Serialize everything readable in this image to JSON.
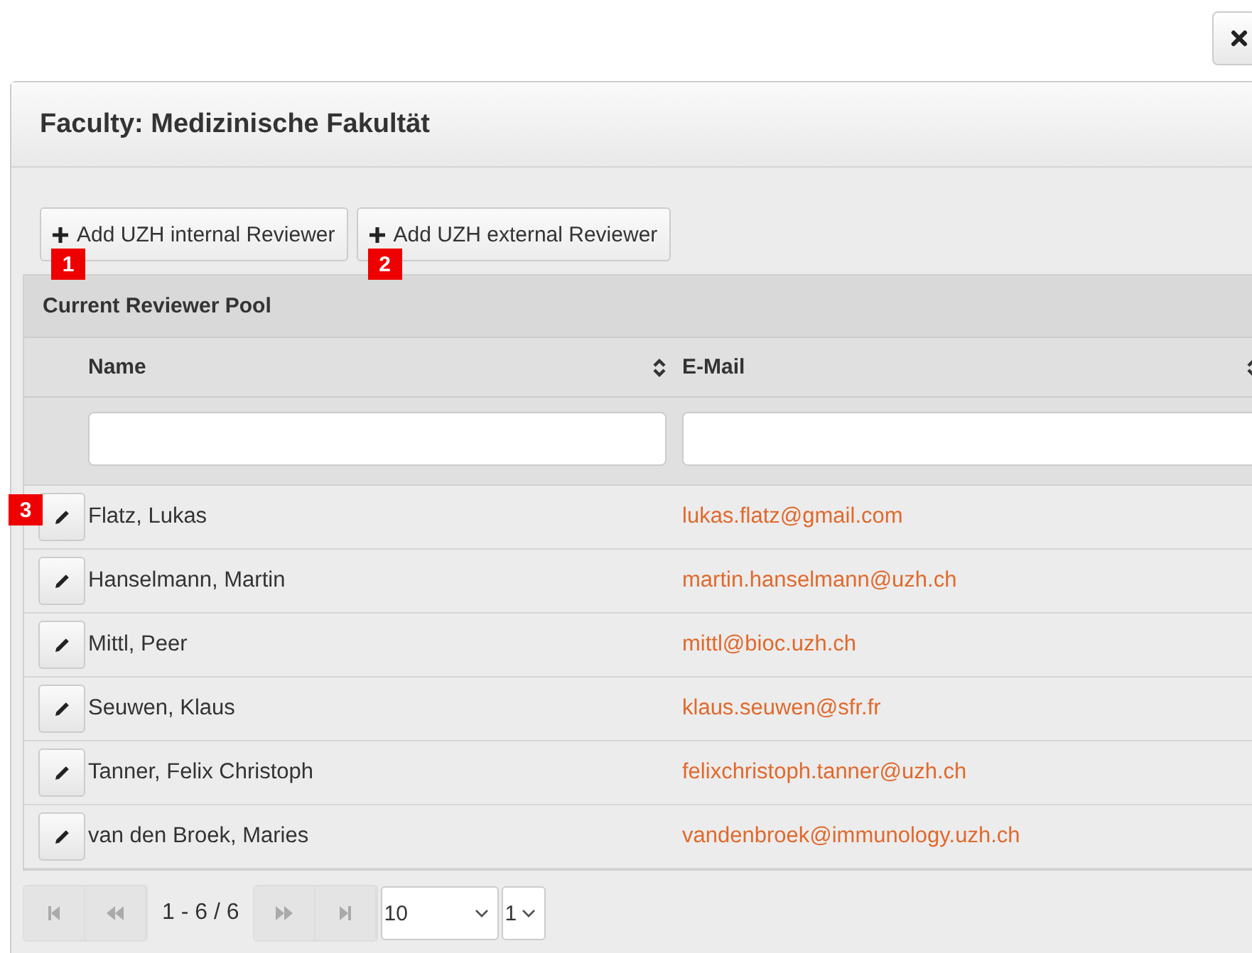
{
  "dialog": {
    "title": "Faculty: Medizinische Fakultät"
  },
  "buttons": [
    {
      "label": "Add UZH internal Reviewer",
      "marker": "1"
    },
    {
      "label": "Add UZH external Reviewer",
      "marker": "2"
    }
  ],
  "pool": {
    "title": "Current Reviewer Pool",
    "columns": [
      {
        "label": "Name"
      },
      {
        "label": "E-Mail"
      }
    ],
    "rows": [
      {
        "name": "Flatz, Lukas",
        "email": "lukas.flatz@gmail.com",
        "marker": "3"
      },
      {
        "name": "Hanselmann, Martin",
        "email": "martin.hanselmann@uzh.ch"
      },
      {
        "name": "Mittl, Peer",
        "email": "mittl@bioc.uzh.ch"
      },
      {
        "name": "Seuwen, Klaus",
        "email": "klaus.seuwen@sfr.fr"
      },
      {
        "name": "Tanner, Felix Christoph",
        "email": "felixchristoph.tanner@uzh.ch"
      },
      {
        "name": "van den Broek, Maries",
        "email": "vandenbroek@immunology.uzh.ch"
      }
    ]
  },
  "pager": {
    "range": "1 - 6 / 6",
    "page_size": "10",
    "page": "1"
  }
}
